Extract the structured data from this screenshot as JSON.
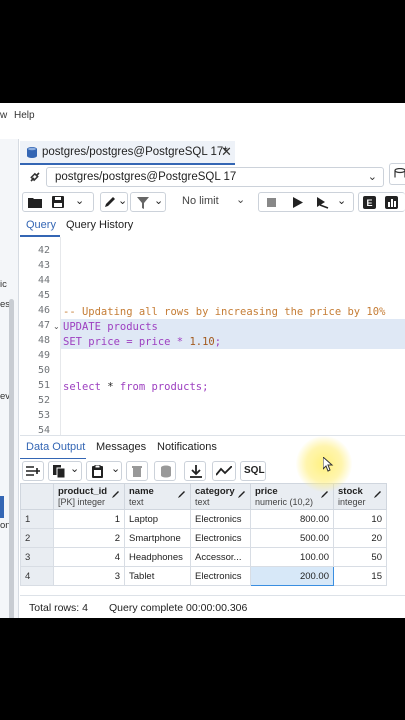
{
  "menu": {
    "item_view_fragment": "w",
    "item_help": "Help"
  },
  "left_panel": {
    "frag1": "ic",
    "frag2": "es",
    "frag3": "ev",
    "frag4": "on"
  },
  "editor_tab": {
    "title": "postgres/postgres@PostgreSQL 17*"
  },
  "connection": {
    "value": "postgres/postgres@PostgreSQL 17"
  },
  "toolbar": {
    "limit_label": "No limit"
  },
  "query_tabs": [
    "Query",
    "Query History"
  ],
  "editor": {
    "lines": [
      {
        "n": "42",
        "text": ""
      },
      {
        "n": "43",
        "text": ""
      },
      {
        "n": "44",
        "text": ""
      },
      {
        "n": "45",
        "text": ""
      },
      {
        "n": "46",
        "text": "-- Updating all rows by increasing the price by 10%"
      },
      {
        "n": "47",
        "text": "UPDATE products"
      },
      {
        "n": "48",
        "text": "SET price = price * 1.10;"
      },
      {
        "n": "49",
        "text": ""
      },
      {
        "n": "50",
        "text": ""
      },
      {
        "n": "51",
        "text": "select * from products;"
      },
      {
        "n": "52",
        "text": ""
      },
      {
        "n": "53",
        "text": ""
      },
      {
        "n": "54",
        "text": ""
      }
    ],
    "tokens": {
      "comment": "-- Updating all rows by increasing the price by 10%",
      "update_kw": "UPDATE",
      "products_1": " products",
      "set_kw": "SET",
      "set_expr": " price = price * ",
      "set_num": "1.10",
      "semi": ";",
      "select_kw": "select",
      "star": " * ",
      "from_kw": "from",
      "products_2": " products;"
    }
  },
  "result_tabs": [
    "Data Output",
    "Messages",
    "Notifications"
  ],
  "result_toolbar": {
    "sql_label": "SQL"
  },
  "table": {
    "columns": [
      {
        "name": "product_id",
        "type": "[PK] integer"
      },
      {
        "name": "name",
        "type": "text"
      },
      {
        "name": "category",
        "type": "text"
      },
      {
        "name": "price",
        "type": "numeric (10,2)"
      },
      {
        "name": "stock",
        "type": "integer"
      }
    ],
    "rows": [
      {
        "rn": "1",
        "product_id": "1",
        "name": "Laptop",
        "category": "Electronics",
        "price": "800.00",
        "stock": "10"
      },
      {
        "rn": "2",
        "product_id": "2",
        "name": "Smartphone",
        "category": "Electronics",
        "price": "500.00",
        "stock": "20"
      },
      {
        "rn": "3",
        "product_id": "4",
        "name": "Headphones",
        "category": "Accessor...",
        "price": "100.00",
        "stock": "50"
      },
      {
        "rn": "4",
        "product_id": "3",
        "name": "Tablet",
        "category": "Electronics",
        "price": "200.00",
        "stock": "15"
      }
    ]
  },
  "status": {
    "total_rows": "Total rows: 4",
    "query_status": "Query complete 00:00:00.306"
  },
  "colors": {
    "accent": "#3466b4",
    "comment": "#c57d36",
    "keyword": "#9d3fc0",
    "highlight_line": "#dfe8f5",
    "selected_cell": "#d7e8f8"
  }
}
